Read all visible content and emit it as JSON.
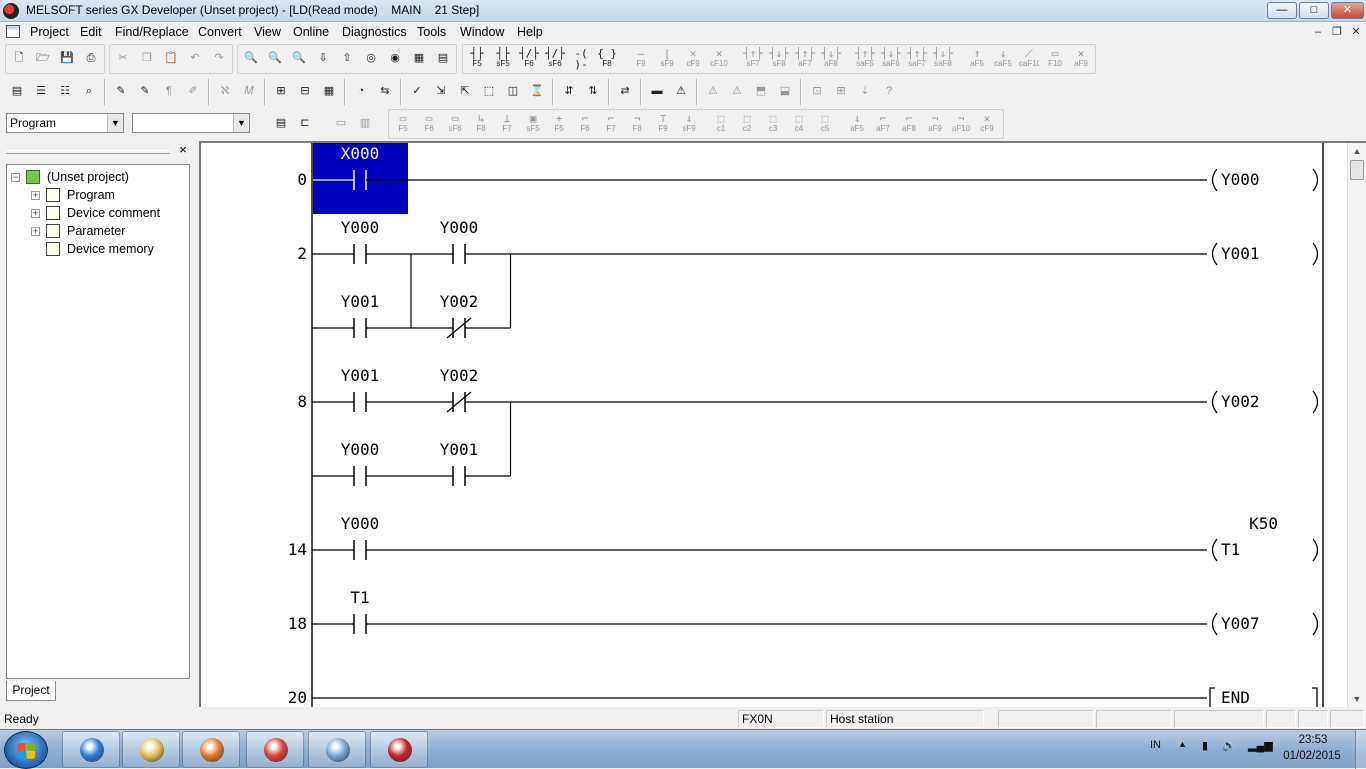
{
  "window": {
    "title": "MELSOFT series GX Developer (Unset project) - [LD(Read mode)    MAIN    21 Step]",
    "controls": {
      "minimize": "—",
      "maximize": "□",
      "close": "✕"
    }
  },
  "menu": {
    "items": [
      "Project",
      "Edit",
      "Find/Replace",
      "Convert",
      "View",
      "Online",
      "Diagnostics",
      "Tools",
      "Window",
      "Help"
    ],
    "mdi": {
      "minimize": "–",
      "restore": "❐",
      "close": "✕"
    }
  },
  "toolbar_row1": {
    "file_buttons": [
      {
        "name": "new",
        "glyph": "🗋"
      },
      {
        "name": "open",
        "glyph": "🗁"
      },
      {
        "name": "save",
        "glyph": "💾"
      },
      {
        "name": "print",
        "glyph": "⎙"
      }
    ],
    "edit_buttons": [
      {
        "name": "cut",
        "glyph": "✂"
      },
      {
        "name": "copy",
        "glyph": "❐"
      },
      {
        "name": "paste",
        "glyph": "📋"
      },
      {
        "name": "undo",
        "glyph": "↶"
      },
      {
        "name": "redo",
        "glyph": "↷"
      }
    ],
    "find_buttons": [
      {
        "name": "find-device",
        "glyph": "🔍"
      },
      {
        "name": "find-instruction",
        "glyph": "🔍"
      },
      {
        "name": "find-contact",
        "glyph": "🔍"
      },
      {
        "name": "write-to-plc",
        "glyph": "⇩"
      },
      {
        "name": "read-from-plc",
        "glyph": "⇧"
      },
      {
        "name": "monitor-mode",
        "glyph": "◎"
      },
      {
        "name": "monitor-stop",
        "glyph": "◉"
      },
      {
        "name": "ladder-monitor",
        "glyph": "▦"
      },
      {
        "name": "entry-monitor",
        "glyph": "▤"
      }
    ],
    "ladder_keys": [
      {
        "sym": "┤├",
        "key": "F5"
      },
      {
        "sym": "┤├",
        "key": "sF5"
      },
      {
        "sym": "┤/├",
        "key": "F6"
      },
      {
        "sym": "┤/├",
        "key": "sF6"
      },
      {
        "sym": "-( )-",
        "key": "F7"
      },
      {
        "sym": "{ }",
        "key": "F8"
      },
      {
        "sym": "—",
        "key": "F9"
      },
      {
        "sym": "|",
        "key": "sF9"
      },
      {
        "sym": "✕",
        "key": "cF9"
      },
      {
        "sym": "✕",
        "key": "cF10"
      },
      {
        "sym": "┤↑├",
        "key": "sF7"
      },
      {
        "sym": "┤↓├",
        "key": "sF8"
      },
      {
        "sym": "┤↑├",
        "key": "aF7"
      },
      {
        "sym": "┤↓├",
        "key": "aF8"
      },
      {
        "sym": "┤↑├",
        "key": "saF5"
      },
      {
        "sym": "┤↓├",
        "key": "saF6"
      },
      {
        "sym": "┤↑├",
        "key": "saF7"
      },
      {
        "sym": "┤↓├",
        "key": "saF8"
      },
      {
        "sym": "↑",
        "key": "aF5"
      },
      {
        "sym": "↓",
        "key": "caF5"
      },
      {
        "sym": "⟋",
        "key": "caF10"
      },
      {
        "sym": "▭",
        "key": "F10"
      },
      {
        "sym": "✕",
        "key": "aF9"
      }
    ]
  },
  "toolbar_row2": {
    "buttons": [
      {
        "name": "project-data-list",
        "glyph": "▤"
      },
      {
        "name": "ladder-view",
        "glyph": "☰"
      },
      {
        "name": "list-view",
        "glyph": "☷"
      },
      {
        "name": "zoom",
        "glyph": "⌕"
      },
      {
        "name": "comment",
        "glyph": "✎"
      },
      {
        "name": "device-comment",
        "glyph": "✎"
      },
      {
        "name": "statement",
        "glyph": "¶"
      },
      {
        "name": "note",
        "glyph": "✐"
      },
      {
        "name": "alias",
        "glyph": "ℵ"
      },
      {
        "name": "macro",
        "glyph": "𝑀"
      },
      {
        "name": "cross-ref",
        "glyph": "⊞"
      },
      {
        "name": "device-use",
        "glyph": "⊟"
      },
      {
        "name": "table",
        "glyph": "▦"
      },
      {
        "name": "batch-monitor",
        "glyph": "◔"
      },
      {
        "name": "convert",
        "glyph": "⇆"
      },
      {
        "name": "check",
        "glyph": "✓"
      },
      {
        "name": "step-read",
        "glyph": "⇲"
      },
      {
        "name": "step-write",
        "glyph": "⇱"
      },
      {
        "name": "block",
        "glyph": "⬚"
      },
      {
        "name": "register",
        "glyph": "◫"
      },
      {
        "name": "timing",
        "glyph": "⌛"
      },
      {
        "name": "sampling",
        "glyph": "⇵"
      },
      {
        "name": "trace",
        "glyph": "⇅"
      },
      {
        "name": "online-change",
        "glyph": "⇄"
      },
      {
        "name": "comm-setup",
        "glyph": "▬"
      },
      {
        "name": "error-jump",
        "glyph": "⚠"
      },
      {
        "name": "error-list",
        "glyph": "⚠"
      },
      {
        "name": "error-step",
        "glyph": "⚠"
      },
      {
        "name": "sfc",
        "glyph": "⬒"
      },
      {
        "name": "sfc-all",
        "glyph": "⬓"
      },
      {
        "name": "sfc-monitor",
        "glyph": "⊡"
      },
      {
        "name": "sfc-zoom",
        "glyph": "⊞"
      },
      {
        "name": "sfc-batch",
        "glyph": "⇣"
      },
      {
        "name": "help",
        "glyph": "?"
      }
    ]
  },
  "toolbar_row3": {
    "data_type_combo": "Program",
    "second_combo": "",
    "sfc_keys": [
      {
        "sym": "▭",
        "key": "F5"
      },
      {
        "sym": "▭",
        "key": "F6"
      },
      {
        "sym": "▭",
        "key": "sF6"
      },
      {
        "sym": "↳",
        "key": "F8"
      },
      {
        "sym": "⊥",
        "key": "F7"
      },
      {
        "sym": "▣",
        "key": "sF5"
      },
      {
        "sym": "+",
        "key": "F5"
      },
      {
        "sym": "⌐",
        "key": "F6"
      },
      {
        "sym": "⌐",
        "key": "F7"
      },
      {
        "sym": "¬",
        "key": "F8"
      },
      {
        "sym": "⊤",
        "key": "F9"
      },
      {
        "sym": "↓",
        "key": "sF9"
      },
      {
        "sym": "⬚",
        "key": "c1"
      },
      {
        "sym": "⬚",
        "key": "c2"
      },
      {
        "sym": "⬚",
        "key": "c3"
      },
      {
        "sym": "⬚",
        "key": "c4"
      },
      {
        "sym": "⬚",
        "key": "c5"
      },
      {
        "sym": "↓",
        "key": "aF5"
      },
      {
        "sym": "⌐",
        "key": "aF7"
      },
      {
        "sym": "⌐",
        "key": "aF8"
      },
      {
        "sym": "¬",
        "key": "aF9"
      },
      {
        "sym": "¬",
        "key": "aF10"
      },
      {
        "sym": "✕",
        "key": "cF9"
      }
    ]
  },
  "project_panel": {
    "close": "×",
    "tree": [
      {
        "label": "(Unset project)",
        "level": 0,
        "expander": "−",
        "icon": "project-icon"
      },
      {
        "label": "Program",
        "level": 1,
        "expander": "+",
        "icon": "program-icon"
      },
      {
        "label": "Device comment",
        "level": 1,
        "expander": "+",
        "icon": "device-comment-icon"
      },
      {
        "label": "Parameter",
        "level": 1,
        "expander": "+",
        "icon": "parameter-icon"
      },
      {
        "label": "Device memory",
        "level": 1,
        "expander": "",
        "icon": "device-memory-icon"
      }
    ],
    "tab": "Project"
  },
  "ladder": {
    "rungs": [
      {
        "step": "0",
        "output": "Y000",
        "branches": [
          [
            {
              "device": "X000",
              "type": "NO",
              "selected": true
            }
          ]
        ]
      },
      {
        "step": "2",
        "output": "Y001",
        "branches": [
          [
            {
              "device": "Y000",
              "type": "NO"
            },
            {
              "device": "Y000",
              "type": "NO"
            }
          ],
          [
            {
              "device": "Y001",
              "type": "NO"
            },
            {
              "device": "Y002",
              "type": "NC"
            }
          ]
        ]
      },
      {
        "step": "8",
        "output": "Y002",
        "branches": [
          [
            {
              "device": "Y001",
              "type": "NO"
            },
            {
              "device": "Y002",
              "type": "NC"
            }
          ],
          [
            {
              "device": "Y000",
              "type": "NO"
            },
            {
              "device": "Y001",
              "type": "NO"
            }
          ]
        ]
      },
      {
        "step": "14",
        "output": "T1",
        "output_param": "K50",
        "branches": [
          [
            {
              "device": "Y000",
              "type": "NO"
            }
          ]
        ]
      },
      {
        "step": "18",
        "output": "Y007",
        "branches": [
          [
            {
              "device": "T1",
              "type": "NO"
            }
          ]
        ]
      },
      {
        "step": "20",
        "output": "END",
        "output_type": "instruction",
        "branches": []
      }
    ],
    "selection_color": "#0000c0",
    "line_color": "#000000"
  },
  "statusbar": {
    "message": "Ready",
    "plc_type": "FX0N",
    "station": "Host station"
  },
  "taskbar": {
    "apps": [
      {
        "name": "internet-explorer",
        "color": "#2f7fd6"
      },
      {
        "name": "file-explorer",
        "color": "#e7c15a"
      },
      {
        "name": "media-player",
        "color": "#e77b2a"
      },
      {
        "name": "chrome",
        "color": "#db4437"
      },
      {
        "name": "paint",
        "color": "#7aa6d8"
      },
      {
        "name": "gx-developer",
        "color": "#c3262b"
      }
    ],
    "language": "IN",
    "time": "23:53",
    "date": "01/02/2015"
  }
}
